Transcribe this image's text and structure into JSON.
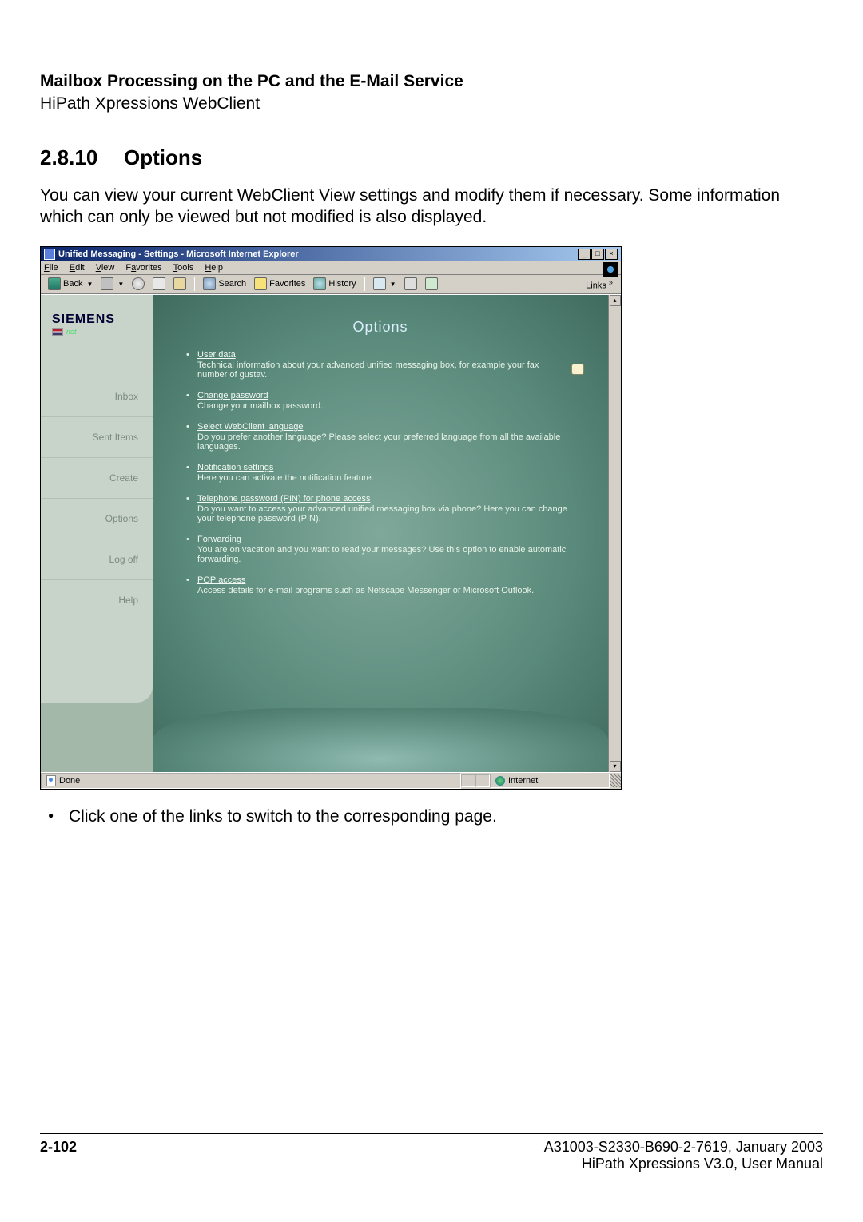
{
  "doc": {
    "title": "Mailbox Processing on the PC and the E-Mail Service",
    "subtitle": "HiPath Xpressions WebClient",
    "section_number": "2.8.10",
    "section_title": "Options",
    "intro": "You can view your current WebClient View settings and modify them if necessary. Some information which can only be viewed but not modified is also displayed.",
    "instruction": "Click one of the links to switch to the corresponding page.",
    "footer_page": "2-102",
    "footer_docid": "A31003-S2330-B690-2-7619, January 2003",
    "footer_product": "HiPath Xpressions V3.0, User Manual"
  },
  "window": {
    "title": "Unified Messaging - Settings - Microsoft Internet Explorer"
  },
  "menubar": {
    "file": "File",
    "edit": "Edit",
    "view": "View",
    "favorites": "Favorites",
    "tools": "Tools",
    "help": "Help"
  },
  "toolbar": {
    "back": "Back",
    "search": "Search",
    "favorites": "Favorites",
    "history": "History",
    "links": "Links"
  },
  "sidebar": {
    "brand": "SIEMENS",
    "brand_sub": "net",
    "items": [
      "Inbox",
      "Sent Items",
      "Create",
      "Options",
      "Log off",
      "Help"
    ]
  },
  "main": {
    "heading": "Options",
    "items": [
      {
        "link": "User data",
        "desc": "Technical information about your advanced unified messaging box, for example your fax number of gustav."
      },
      {
        "link": "Change password",
        "desc": "Change your mailbox password."
      },
      {
        "link": "Select WebClient language",
        "desc": "Do you prefer another language? Please select your preferred language from all the available languages."
      },
      {
        "link": "Notification settings",
        "desc": "Here you can activate the notification feature."
      },
      {
        "link": "Telephone password (PIN) for phone access",
        "desc": "Do you want to access your advanced unified messaging box via phone? Here you can change your telephone password (PIN)."
      },
      {
        "link": "Forwarding",
        "desc": "You are on vacation and you want to read your messages? Use this option to enable automatic forwarding."
      },
      {
        "link": "POP access",
        "desc": "Access details for e-mail programs such as Netscape Messenger or Microsoft Outlook."
      }
    ]
  },
  "statusbar": {
    "status": "Done",
    "zone": "Internet"
  }
}
